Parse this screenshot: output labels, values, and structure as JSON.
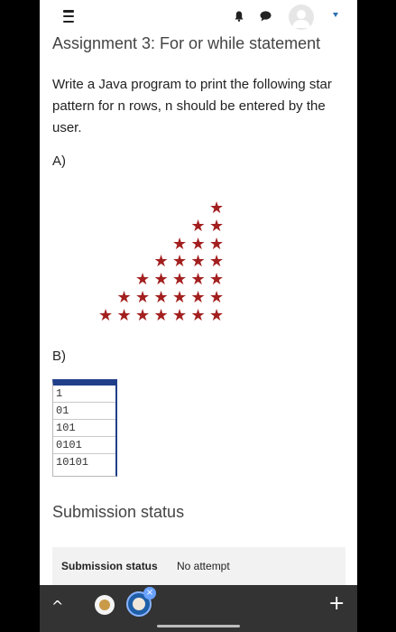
{
  "topbar": {
    "menu_icon": "hamburger-icon",
    "notification_icon": "bell-icon",
    "messages_icon": "chat-bubble-icon",
    "user_icon": "avatar-icon",
    "dropdown_icon": "caret-down-icon"
  },
  "assignment": {
    "title": "Assignment 3: For or while statement",
    "question": "Write a  Java program to print the  following star pattern for n rows, n should be entered by the user.",
    "part_a_label": "A)",
    "part_b_label": "B)"
  },
  "pattern_a": {
    "rows": [
      1,
      2,
      3,
      4,
      5,
      6,
      7
    ],
    "glyph": "★",
    "color": "#a31f1f"
  },
  "pattern_b": {
    "lines": [
      "1",
      "01",
      "101",
      "0101",
      "10101"
    ],
    "border_color": "#1f3f8a"
  },
  "submission": {
    "heading": "Submission status",
    "row_key": "Submission status",
    "row_value": "No attempt"
  },
  "navbar": {
    "up_icon": "chevron-up-icon",
    "up_glyph": "^",
    "plus_glyph": "+",
    "badge_glyph": "×",
    "color": "#333333"
  }
}
